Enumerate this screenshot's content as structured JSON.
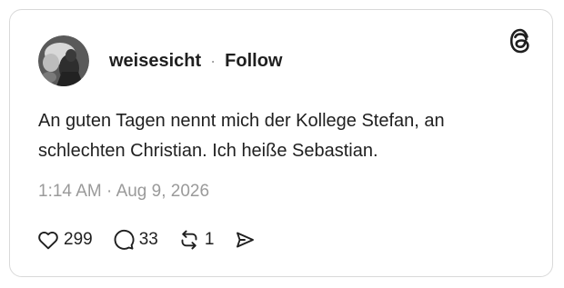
{
  "post": {
    "username": "weisesicht",
    "separator": "·",
    "follow_label": "Follow",
    "text_line1": "An guten Tagen nennt mich der Kollege Stefan, an",
    "text_line2": "schlechten Christian. Ich heiße Sebastian.",
    "time": "1:14 AM",
    "date_separator": "·",
    "date": "Aug 9, 2026"
  },
  "actions": {
    "likes": "299",
    "replies": "33",
    "reposts": "1"
  },
  "icons": {
    "brand": "threads-logo-icon",
    "like": "heart-icon",
    "reply": "comment-bubble-icon",
    "repost": "repost-icon",
    "share": "send-icon"
  },
  "colors": {
    "text": "#1f1f1f",
    "muted": "#9a9a9a",
    "border": "#d9d9d9"
  }
}
